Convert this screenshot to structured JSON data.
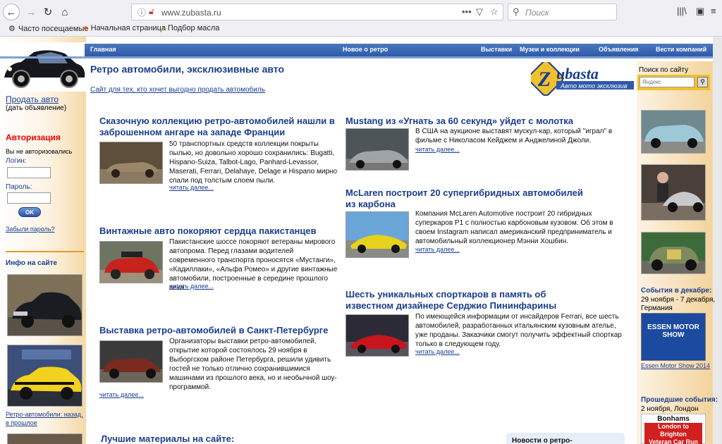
{
  "browser": {
    "url": "www.zubasta.ru",
    "search_placeholder": "Поиск",
    "bookmarks": [
      "Часто посещаемые",
      "Начальная страница",
      "Подбор масла"
    ]
  },
  "nav": [
    "Главная",
    "Новое о ретро",
    "Выставки",
    "Музеи и коллекции",
    "Объявления",
    "Вести компаний"
  ],
  "header": {
    "title": "Ретро автомобили, эксклюзивные авто",
    "subtitle": "Сайт для тех, кто хочет выгодно продать автомобиль",
    "logo_main": "Zubasta",
    "logo_tag": "Авто мото эксклюзив",
    "search_label": "Поиск по сайту",
    "search_placeholder": "Яндекс"
  },
  "left": {
    "sell_link": "Продать авто",
    "sell_sub": "(дать объявление)",
    "auth_title": "Авторизация",
    "auth_status": "Вы не авторизовались",
    "login_label": "Логин:",
    "pass_label": "Пароль:",
    "ok": "OK",
    "forgot": "Забыли пароль?",
    "info_title": "Инфо на сайте",
    "caption": "Ретро-автомобили: назад, в прошлое"
  },
  "right": {
    "events_title": "События в декабре:",
    "events_date": "29 ноября - 7 декабря, Германия",
    "essen_img_text": "ESSEN MOTOR SHOW",
    "essen_link": "Essen Motor Show 2014",
    "past_title": "Прошедшие события:",
    "past_date": "2 ноября, Лондон",
    "bonhams_1": "Bonhams",
    "bonhams_2": "London to Brighton",
    "bonhams_3": "Veteran Car Run"
  },
  "read_more": "читать далее...",
  "articles_left": [
    {
      "title": "Сказочную коллекцию ретро-автомобилей нашли в заброшенном ангаре на западе Франции",
      "text": "50 транспортных средств коллекции покрыты пылью, но довольно хорошо сохранились: Bugatti, Hispano-Suiza, Talbot-Lago, Panhard-Levassor, Maserati, Ferrari, Delahaye, Delage и Hispano мирно спали под толстым слоем пыли."
    },
    {
      "title": "Винтажные авто покоряют сердца пакистанцев",
      "text": "Пакистанские шоссе покоряют ветераны мирового автопрома. Перед глазами водителей современного транспорта проносятся «Мустанги», «Кадиллаки», «Альфа Ромео» и другие винтажные автомобили, построенные в середине прошлого века."
    },
    {
      "title": "Выставка ретро-автомобилей в Санкт-Петербурге",
      "text": "Организаторы выставки ретро-автомобилей, открытие которой состоялось 29 ноября в Выборгском районе Петербурга, решили удивить гостей не только отлично сохранившимися машинами из прошлого века, но и необычной шоу-программой."
    }
  ],
  "articles_right": [
    {
      "title": "Mustang из «Угнать за 60 секунд» уйдет с молотка",
      "text": "В США на аукционе выставят мускул-кар, который \"играл\" в фильме с Николасом Кейджем и Анджелиной Джоли."
    },
    {
      "title": "McLaren построит 20 супергибридных автомобилей из карбона",
      "text": "Компания McLaren Automotive построит 20 гибридных суперкаров P1 с полностью карбоновым кузовом. Об этом в своем Instagram написал американский предприниматель и автомобильный коллекционер Мэнни Хошбин."
    },
    {
      "title": "Шесть уникальных спорткаров в память об известном дизайнере Серджио Пининфарины",
      "text": "По имеющейся информации от инсайдеров Ferrari, все шесть автомобилей, разработанных итальянским кузовным ателье, уже проданы. Заказчики смогут получить эффектный спорткар только в следующем году."
    }
  ],
  "best": "Лучшие материалы на сайте:",
  "news_box": "Новости о ретро-"
}
